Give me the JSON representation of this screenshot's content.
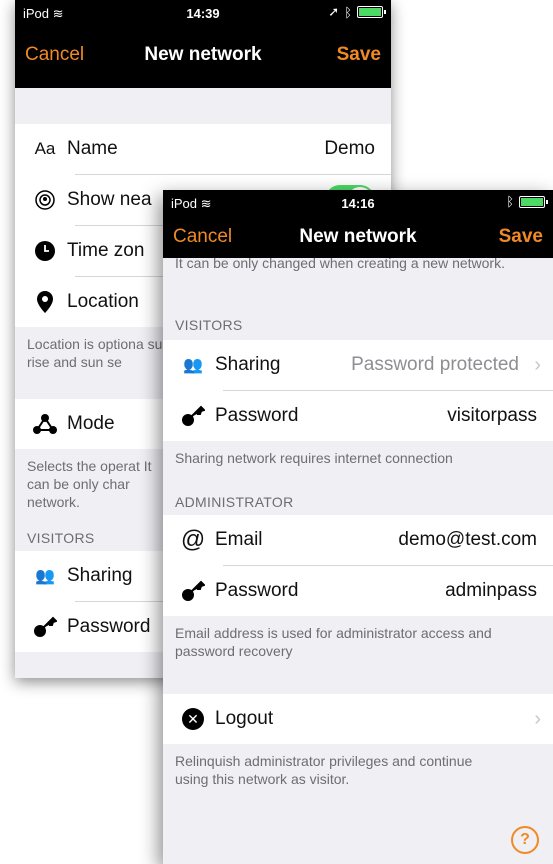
{
  "back": {
    "status": {
      "carrier": "iPod",
      "time": "14:39"
    },
    "nav": {
      "cancel": "Cancel",
      "title": "New network",
      "save": "Save"
    },
    "rows": {
      "name": {
        "label": "Name",
        "value": "Demo",
        "icon": "Aa"
      },
      "show": {
        "label": "Show nea"
      },
      "timezone": {
        "label": "Time zon"
      },
      "location": {
        "label": "Location"
      }
    },
    "location_footer": "Location is optiona sun rise and sun se",
    "mode": {
      "label": "Mode"
    },
    "mode_footer": "Selects the operat It can be only char network.",
    "visitors_header": "VISITORS",
    "sharing": {
      "label": "Sharing"
    },
    "password": {
      "label": "Password"
    }
  },
  "front": {
    "status": {
      "carrier": "iPod",
      "time": "14:16"
    },
    "nav": {
      "cancel": "Cancel",
      "title": "New network",
      "save": "Save"
    },
    "top_text": "It can be only changed when creating a new network.",
    "visitors_header": "VISITORS",
    "sharing": {
      "label": "Sharing",
      "value": "Password protected"
    },
    "visitor_password": {
      "label": "Password",
      "value": "visitorpass"
    },
    "visitors_footer": "Sharing network requires internet connection",
    "admin_header": "ADMINISTRATOR",
    "email": {
      "label": "Email",
      "value": "demo@test.com"
    },
    "admin_password": {
      "label": "Password",
      "value": "adminpass"
    },
    "admin_footer": "Email address is used for administrator access and password recovery",
    "logout": {
      "label": "Logout"
    },
    "logout_footer": "Relinquish administrator privileges and continue using this network as visitor.",
    "help": "?"
  },
  "colors": {
    "accent": "#f08a24",
    "toggle_on": "#4cd964"
  }
}
